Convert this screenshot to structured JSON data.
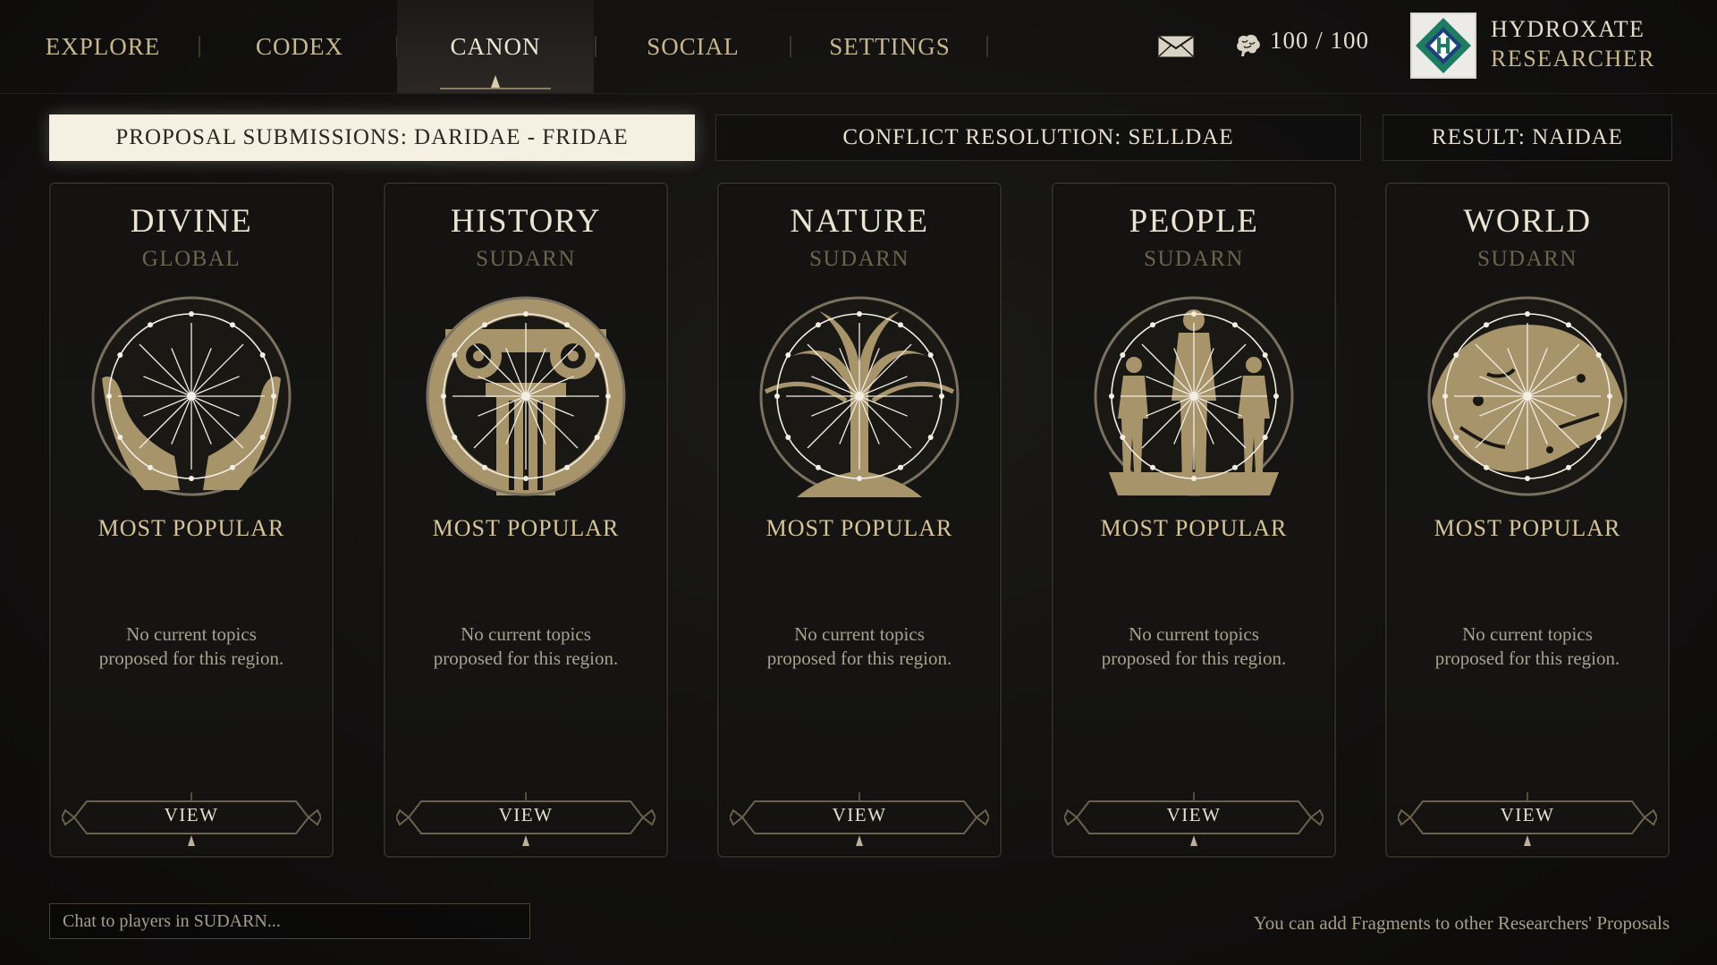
{
  "nav": {
    "tabs": [
      {
        "label": "EXPLORE",
        "active": false
      },
      {
        "label": "CODEX",
        "active": false
      },
      {
        "label": "CANON",
        "active": true
      },
      {
        "label": "SOCIAL",
        "active": false
      },
      {
        "label": "SETTINGS",
        "active": false
      }
    ],
    "mail_icon": "envelope-icon",
    "energy_icon": "brain-icon",
    "energy": "100 / 100",
    "user": {
      "name": "HYDROXATE",
      "role": "RESEARCHER",
      "avatar_icon": "diamond-h-emblem"
    }
  },
  "phases": [
    {
      "label": "PROPOSAL SUBMISSIONS: DARIDAE - FRIDAE",
      "active": true
    },
    {
      "label": "CONFLICT RESOLUTION: SELLDAE",
      "active": false
    },
    {
      "label": "RESULT: NAIDAE",
      "active": false
    }
  ],
  "cards": [
    {
      "title": "DIVINE",
      "region": "GLOBAL",
      "emblem": "hands-icon",
      "popular_label": "MOST POPULAR",
      "empty_text": "No current topics\nproposed for this region.",
      "view_label": "VIEW"
    },
    {
      "title": "HISTORY",
      "region": "SUDARN",
      "emblem": "pillar-icon",
      "popular_label": "MOST POPULAR",
      "empty_text": "No current topics\nproposed for this region.",
      "view_label": "VIEW"
    },
    {
      "title": "NATURE",
      "region": "SUDARN",
      "emblem": "tree-icon",
      "popular_label": "MOST POPULAR",
      "empty_text": "No current topics\nproposed for this region.",
      "view_label": "VIEW"
    },
    {
      "title": "PEOPLE",
      "region": "SUDARN",
      "emblem": "figures-icon",
      "popular_label": "MOST POPULAR",
      "empty_text": "No current topics\nproposed for this region.",
      "view_label": "VIEW"
    },
    {
      "title": "WORLD",
      "region": "SUDARN",
      "emblem": "globe-icon",
      "popular_label": "MOST POPULAR",
      "empty_text": "No current topics\nproposed for this region.",
      "view_label": "VIEW"
    }
  ],
  "chat": {
    "placeholder": "Chat to players in SUDARN..."
  },
  "hint": "You can add Fragments to other Researchers' Proposals",
  "colors": {
    "gold": "#c8b78e",
    "active_banner": "#f5f0e2",
    "emblem_fill": "#a8946a",
    "background": "#121110"
  }
}
